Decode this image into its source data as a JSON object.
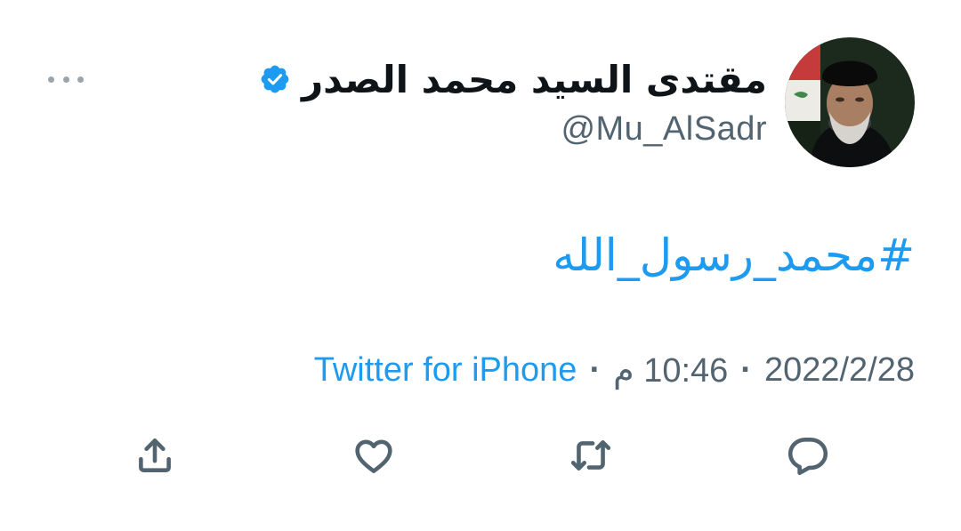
{
  "tweet": {
    "author": {
      "display_name": "مقتدى السيد محمد الصدر",
      "handle": "@Mu_AlSadr",
      "verified": true,
      "avatar": "avatar-photo"
    },
    "text": "#محمد_رسول_الله",
    "meta": {
      "date": "2022/2/28",
      "time": "10:46 م",
      "separator": "·",
      "source": "Twitter for iPhone"
    }
  },
  "icons": {
    "more": "more-dots-icon",
    "verified": "verified-badge-icon",
    "reply": "reply-icon",
    "retweet": "retweet-icon",
    "like": "heart-icon",
    "share": "share-icon"
  },
  "colors": {
    "accent": "#1d9bf0",
    "text": "#0f1419",
    "muted": "#536471",
    "background": "#ffffff"
  }
}
